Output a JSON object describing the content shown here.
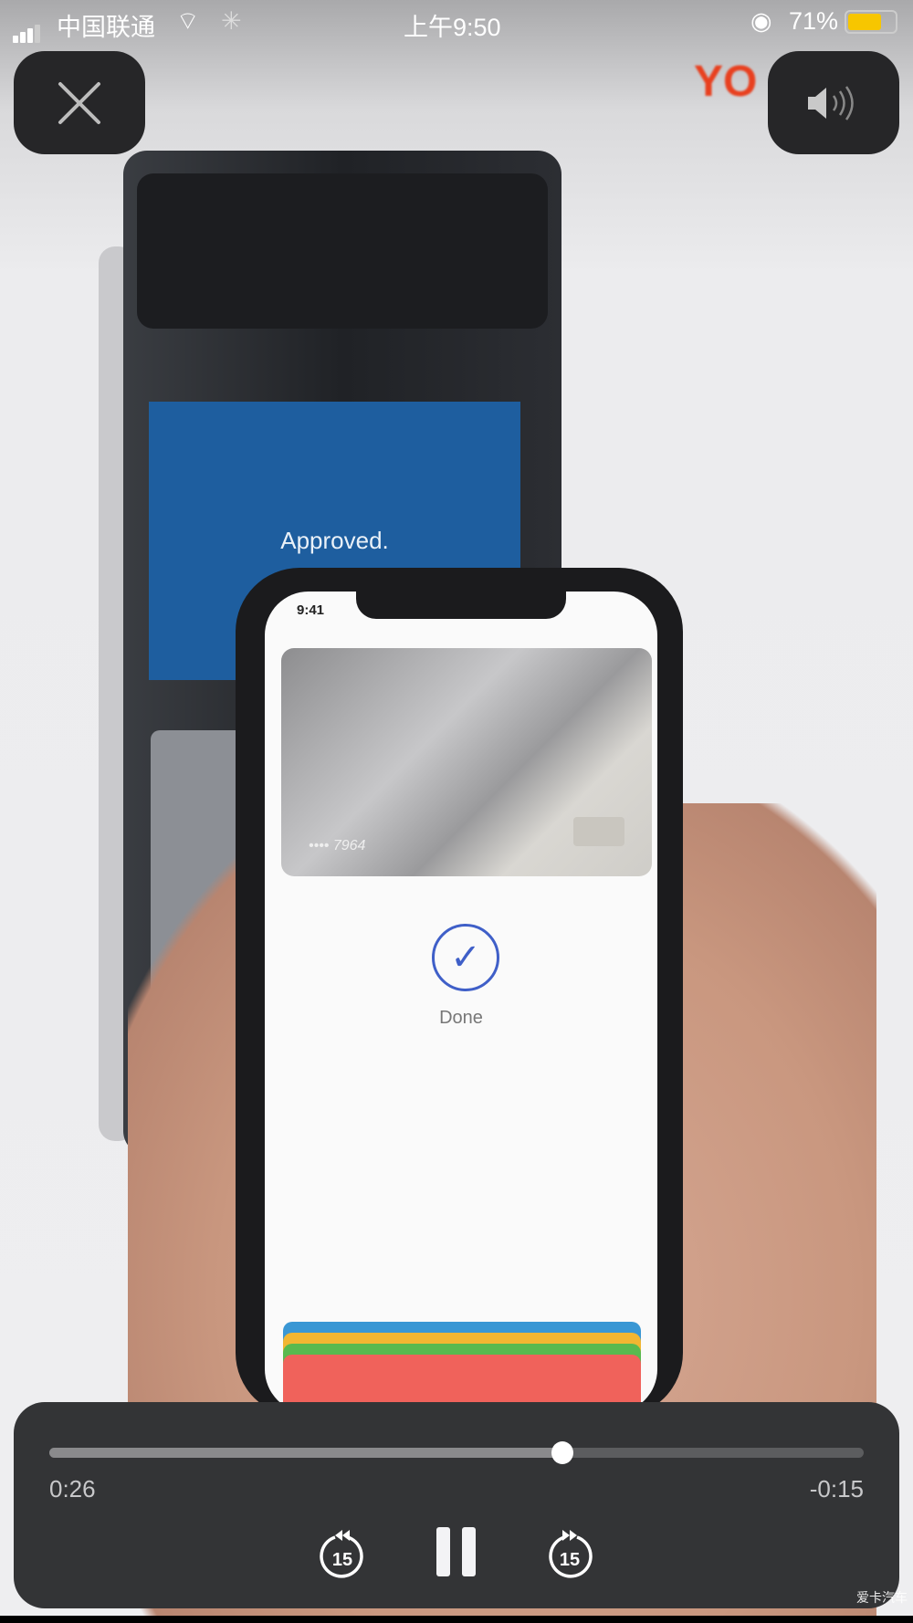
{
  "status_bar": {
    "carrier": "中国联通",
    "time": "上午9:50",
    "battery": "71%",
    "battery_level": 0.71,
    "battery_color": "#f7c600"
  },
  "top_controls": {
    "close_icon": "close-icon",
    "volume_icon": "speaker-volume-icon"
  },
  "video": {
    "logo_text": "YO",
    "pos_screen_text": "Approved.",
    "phone_time": "9:41",
    "card_number": "•••• 7964",
    "status_text": "Done",
    "wallet_card_colors": [
      "#3a97d4",
      "#f2b632",
      "#59b94f",
      "#f0625b"
    ]
  },
  "player": {
    "elapsed": "0:26",
    "remaining": "-0:15",
    "progress": 0.63,
    "skip_back": "15",
    "skip_forward": "15"
  },
  "watermark": "爱卡汽车"
}
